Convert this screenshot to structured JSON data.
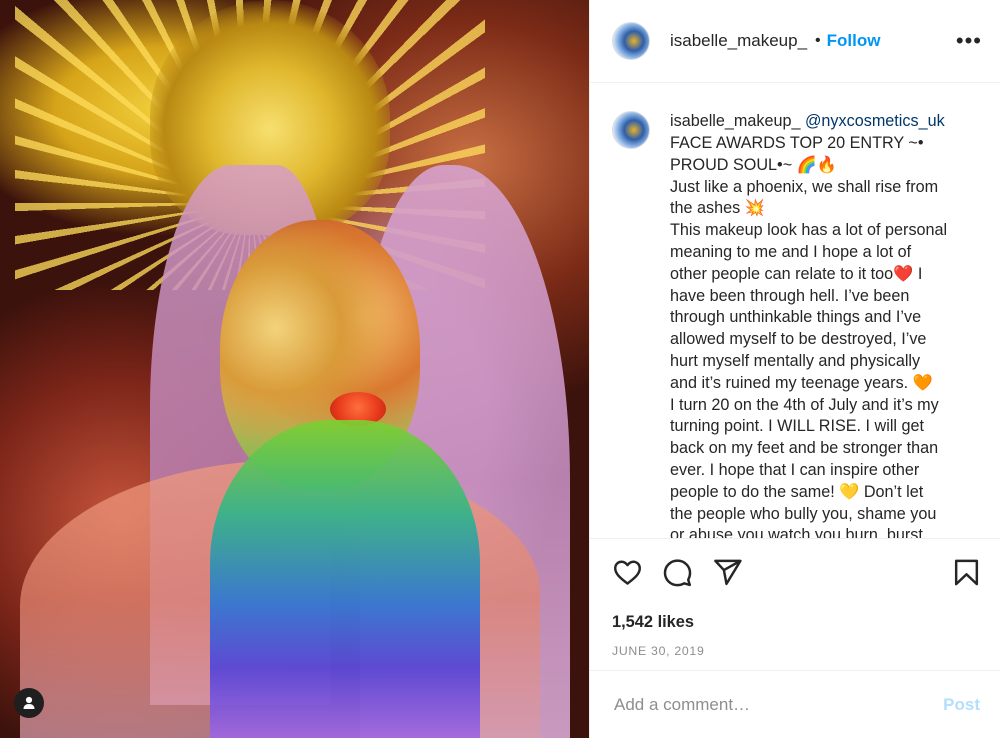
{
  "header": {
    "username": "isabelle_makeup_",
    "separator": "•",
    "follow_label": "Follow",
    "more_label": "•••"
  },
  "caption": {
    "username": "isabelle_makeup_",
    "mention": "@nyxcosmetics_uk",
    "lines": [
      "FACE AWARDS TOP 20 ENTRY ~•",
      "PROUD SOUL•~ 🌈🔥",
      "Just like a phoenix, we shall rise from",
      "the ashes 💥",
      "This makeup look has a lot of personal",
      "meaning to me and I hope a lot of",
      "other people can relate to it too❤️ I",
      "have been through hell. I’ve been",
      "through unthinkable things and I’ve",
      "allowed myself to be destroyed, I’ve",
      "hurt myself mentally and physically",
      "and it’s ruined my teenage years. 🧡",
      "I turn 20 on the 4th of July and it’s my",
      "turning point. I WILL RISE. I will get",
      "back on my feet and be stronger than",
      "ever. I hope that I can inspire other",
      "people to do the same! 💛 Don’t let",
      "the people who bully you, shame you",
      "or abuse you watch you burn, burst"
    ]
  },
  "stats": {
    "likes": "1,542 likes",
    "date": "JUNE 30, 2019"
  },
  "comment": {
    "placeholder": "Add a comment…",
    "post_label": "Post"
  },
  "icons": {
    "like": "heart-icon",
    "comment": "comment-icon",
    "share": "share-icon",
    "save": "bookmark-icon",
    "profile": "user-icon"
  },
  "colors": {
    "accent": "#0095f6",
    "mention": "#00376b",
    "post_disabled": "#b2dffc"
  }
}
